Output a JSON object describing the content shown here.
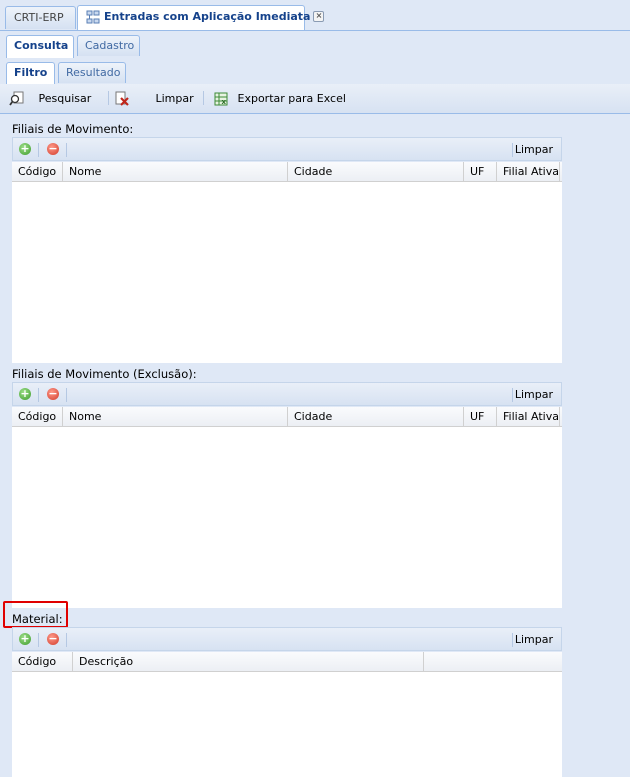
{
  "window_tabs": [
    {
      "label": "CRTI-ERP",
      "active": false
    },
    {
      "label": "Entradas com Aplicação Imediata",
      "active": true
    }
  ],
  "main_tabs": [
    {
      "label": "Consulta",
      "active": true
    },
    {
      "label": "Cadastro",
      "active": false
    }
  ],
  "sub_tabs": [
    {
      "label": "Filtro",
      "active": true
    },
    {
      "label": "Resultado",
      "active": false
    }
  ],
  "toolbar": {
    "search_label": "Pesquisar",
    "clear_label": "Limpar",
    "export_label": "Exportar para Excel"
  },
  "sections": [
    {
      "title": "Filiais de Movimento:",
      "clear_label": "Limpar",
      "columns": [
        "Código",
        "Nome",
        "Cidade",
        "UF",
        "Filial Ativa"
      ],
      "rows": []
    },
    {
      "title": "Filiais de Movimento (Exclusão):",
      "clear_label": "Limpar",
      "columns": [
        "Código",
        "Nome",
        "Cidade",
        "UF",
        "Filial Ativa"
      ],
      "rows": []
    },
    {
      "title": "Material:",
      "clear_label": "Limpar",
      "columns": [
        "Código",
        "Descrição"
      ],
      "rows": []
    }
  ],
  "colors": {
    "panel_bg": "#dfe8f6",
    "border": "#99bbe8",
    "tab_active_text": "#15428b",
    "highlight": "#e00000"
  },
  "icons": {
    "window_tab_icon": "tree-structure-icon",
    "search": "magnifier-icon",
    "clear": "clear-document-icon",
    "export": "excel-icon",
    "add": "add-circle-icon",
    "remove": "remove-circle-icon"
  }
}
